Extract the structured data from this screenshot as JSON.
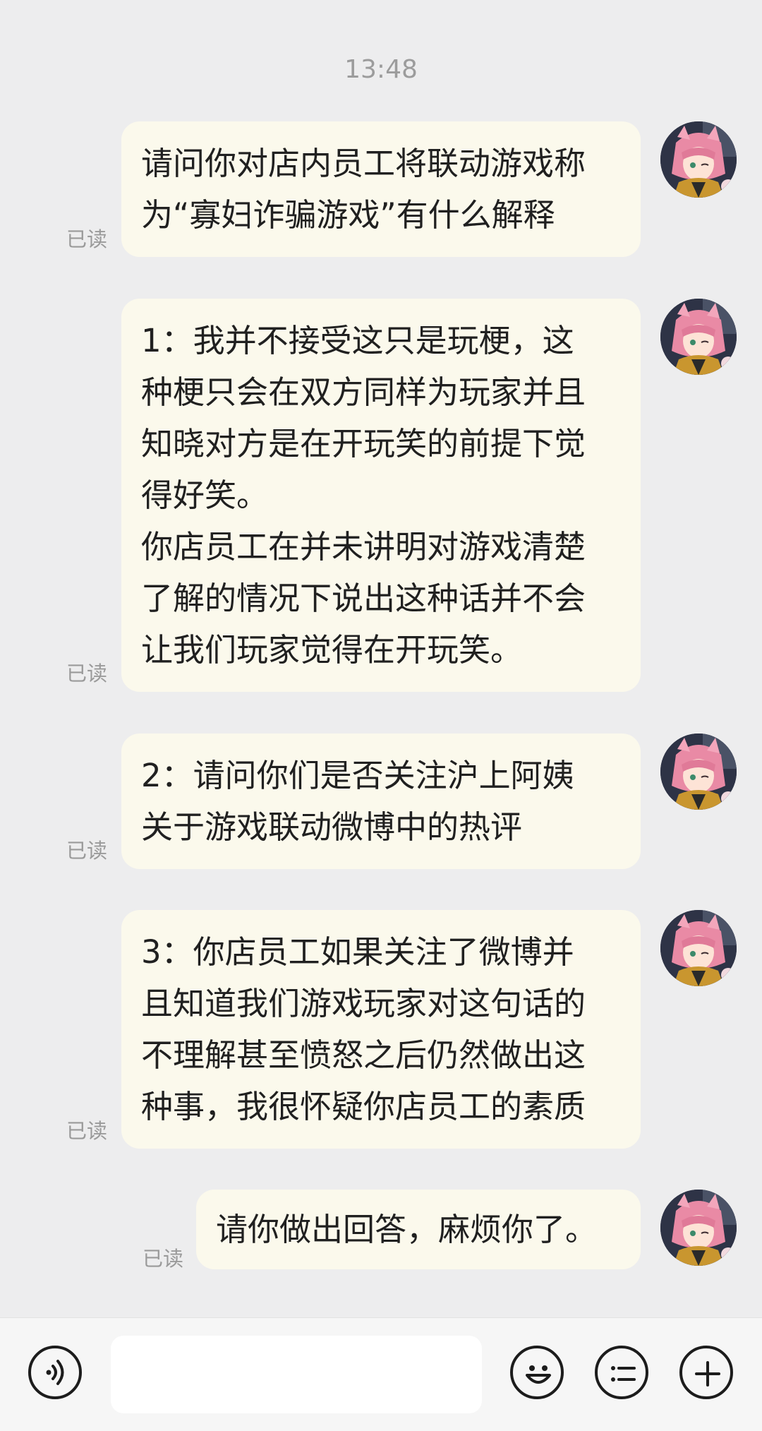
{
  "chat": {
    "timestamp": "13:48",
    "read_label": "已读",
    "messages": [
      {
        "text": "请问你对店内员工将联动游戏称\n为“寡妇诈骗游戏”有什么解释"
      },
      {
        "text": "1：我并不接受这只是玩梗，这\n种梗只会在双方同样为玩家并且\n知晓对方是在开玩笑的前提下觉\n得好笑。\n你店员工在并未讲明对游戏清楚\n了解的情况下说出这种话并不会\n让我们玩家觉得在开玩笑。"
      },
      {
        "text": "2：请问你们是否关注沪上阿姨\n关于游戏联动微博中的热评"
      },
      {
        "text": "3：你店员工如果关注了微博并\n且知道我们游戏玩家对这句话的\n不理解甚至愤怒之后仍然做出这\n种事，我很怀疑你店员工的素质"
      },
      {
        "text": "请你做出回答，麻烦你了。"
      }
    ]
  },
  "input_bar": {
    "message_value": "",
    "icons": {
      "voice": "voice-icon",
      "emoji": "emoji-icon",
      "list": "list-icon",
      "add": "plus-icon"
    }
  },
  "colors": {
    "background": "#ededee",
    "bubble": "#fbf9ec",
    "timestamp": "#9c9c9c",
    "read_status": "#9a9a9a"
  }
}
